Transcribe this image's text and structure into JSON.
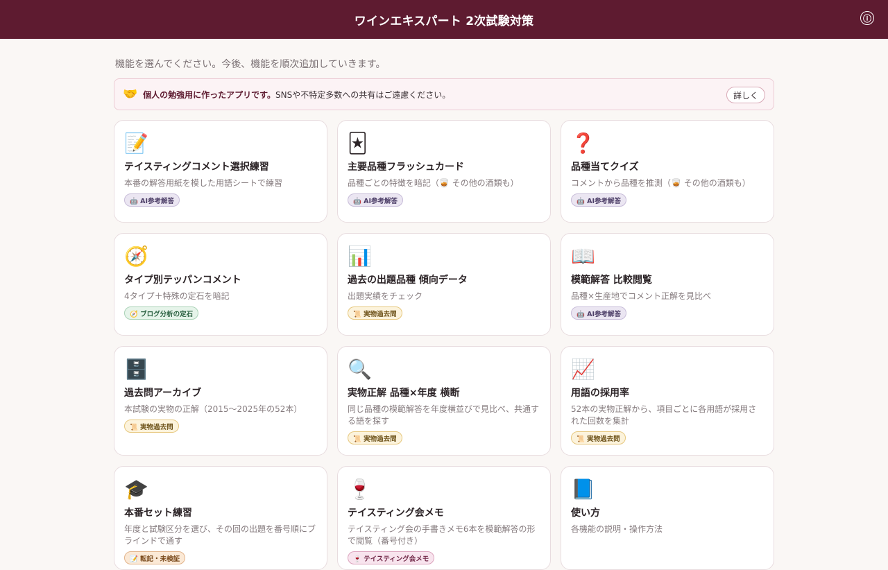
{
  "header": {
    "title": "ワインエキスパート 2次試験対策",
    "info_icon": "ⓘ"
  },
  "intro": "機能を選んでください。今後、機能を順次追加していきます。",
  "notice": {
    "icon": "🤝",
    "strong": "個人の勉強用に作ったアプリです。",
    "text": "SNSや不特定多数への共有はご遠慮ください。",
    "detail_label": "詳しく"
  },
  "cards": [
    {
      "icon": "📝",
      "title": "テイスティングコメント選択練習",
      "desc": "本番の解答用紙を模した用語シートで練習",
      "badge": "🤖 AI参考解答"
    },
    {
      "icon": "🃏",
      "title": "主要品種フラッシュカード",
      "desc": "品種ごとの特徴を暗記（🥃 その他の酒類も）",
      "badge": "🤖 AI参考解答"
    },
    {
      "icon": "❓",
      "title": "品種当てクイズ",
      "desc": "コメントから品種を推測（🥃 その他の酒類も）",
      "badge": "🤖 AI参考解答"
    },
    {
      "icon": "🧭",
      "title": "タイプ別テッパンコメント",
      "desc": "4タイプ＋特殊の定石を暗記",
      "badge": "🧭 ブログ分析の定石"
    },
    {
      "icon": "📊",
      "title": "過去の出題品種 傾向データ",
      "desc": "出題実績をチェック",
      "badge": "📜 実物過去問"
    },
    {
      "icon": "📖",
      "title": "模範解答 比較閲覧",
      "desc": "品種×生産地でコメント正解を見比べ",
      "badge": "🤖 AI参考解答"
    },
    {
      "icon": "🗄️",
      "title": "過去問アーカイブ",
      "desc": "本試験の実物の正解（2015〜2025年の52本）",
      "badge": "📜 実物過去問"
    },
    {
      "icon": "🔍",
      "title": "実物正解 品種×年度 横断",
      "desc": "同じ品種の模範解答を年度横並びで見比べ、共通する語を探す",
      "badge": "📜 実物過去問"
    },
    {
      "icon": "📈",
      "title": "用語の採用率",
      "desc": "52本の実物正解から、項目ごとに各用語が採用された回数を集計",
      "badge": "📜 実物過去問"
    },
    {
      "icon": "🎓",
      "title": "本番セット練習",
      "desc": "年度と試験区分を選び、その回の出題を番号順にブラインドで通す",
      "badge": "📝 転記・未検証"
    },
    {
      "icon": "🍷",
      "title": "テイスティング会メモ",
      "desc": "テイスティング会の手書きメモ6本を模範解答の形で閲覧（番号付き）",
      "badge": "🍷 テイスティング会メモ"
    },
    {
      "icon": "📘",
      "title": "使い方",
      "desc": "各機能の説明・操作方法",
      "badge": ""
    }
  ]
}
